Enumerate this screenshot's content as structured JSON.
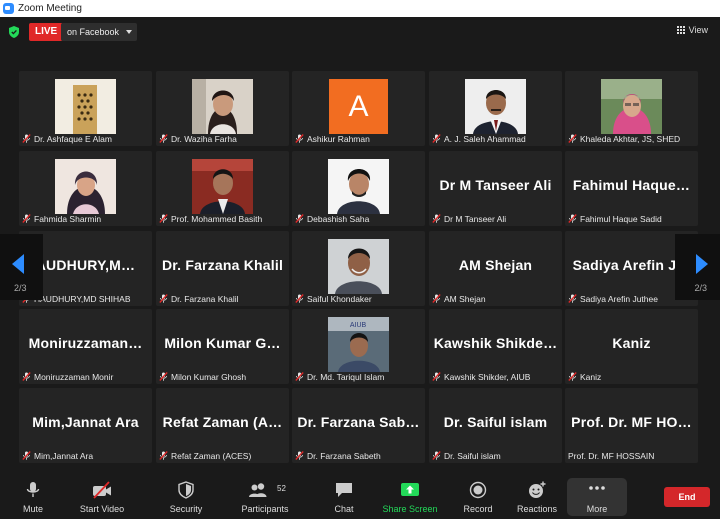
{
  "window": {
    "title": "Zoom Meeting"
  },
  "top": {
    "live_label": "LIVE",
    "destination": "on Facebook",
    "view_label": "View"
  },
  "pager": {
    "left_page": "2/3",
    "right_page": "2/3"
  },
  "participants": [
    {
      "display": "",
      "label": "Dr. Ashfaque E Alam",
      "photo": "ashfaque"
    },
    {
      "display": "",
      "label": "Dr. Waziha Farha",
      "photo": "waziha"
    },
    {
      "display": "",
      "label": "Ashikur Rahman",
      "avatar_letter": "A"
    },
    {
      "display": "",
      "label": "A. J. Saleh Ahammad",
      "photo": "saleh"
    },
    {
      "display": "",
      "label": "Khaleda Akhtar, JS, SHED",
      "photo": "khaleda"
    },
    {
      "display": "",
      "label": "Fahmida Sharmin",
      "photo": "fahmida"
    },
    {
      "display": "",
      "label": "Prof. Mohammed Basith",
      "photo": "basith"
    },
    {
      "display": "",
      "label": "Debashish Saha",
      "photo": "debashish"
    },
    {
      "display": "Dr M Tanseer Ali",
      "label": "Dr M Tanseer Ali"
    },
    {
      "display": "Fahimul  Haque…",
      "label": "Fahimul Haque Sadid"
    },
    {
      "display": "AUDHURY,M…",
      "label": "HAUDHURY,MD SHIHAB"
    },
    {
      "display": "Dr. Farzana Khalil",
      "label": "Dr. Farzana Khalil"
    },
    {
      "display": "",
      "label": "Saiful Khondaker",
      "photo": "saiful"
    },
    {
      "display": "AM Shejan",
      "label": "AM Shejan"
    },
    {
      "display": "Sadiya  Arefin  J…",
      "label": "Sadiya Arefin Juthee"
    },
    {
      "display": "Moniruzzaman…",
      "label": "Moniruzzaman Monir"
    },
    {
      "display": "Milon  Kumar  G…",
      "label": "Milon Kumar Ghosh"
    },
    {
      "display": "",
      "label": "Dr. Md. Tariqul Islam",
      "photo": "tariqul"
    },
    {
      "display": "Kawshik  Shikde…",
      "label": "Kawshik Shikder, AIUB"
    },
    {
      "display": "Kaniz",
      "label": "Kaniz"
    },
    {
      "display": "Mim,Jannat Ara",
      "label": "Mim,Jannat Ara"
    },
    {
      "display": "Refat  Zaman  (A…",
      "label": "Refat Zaman (ACES)"
    },
    {
      "display": "Dr.  Farzana  Sab…",
      "label": "Dr. Farzana Sabeth"
    },
    {
      "display": "Dr. Saiful islam",
      "label": "Dr. Saiful islam"
    },
    {
      "display": "Prof.  Dr.  MF  HO…",
      "label": "Prof. Dr. MF HOSSAIN",
      "no_mic": true
    }
  ],
  "toolbar": {
    "mute": "Mute",
    "start_video": "Start Video",
    "security": "Security",
    "participants": "Participants",
    "participant_count": "52",
    "chat": "Chat",
    "share_screen": "Share Screen",
    "record": "Record",
    "reactions": "Reactions",
    "more": "More",
    "end": "End"
  },
  "colors": {
    "accent": "#2d8cff",
    "live": "#e02828",
    "end": "#d4272a",
    "share": "#23d959",
    "avatar": "#f26d21"
  }
}
